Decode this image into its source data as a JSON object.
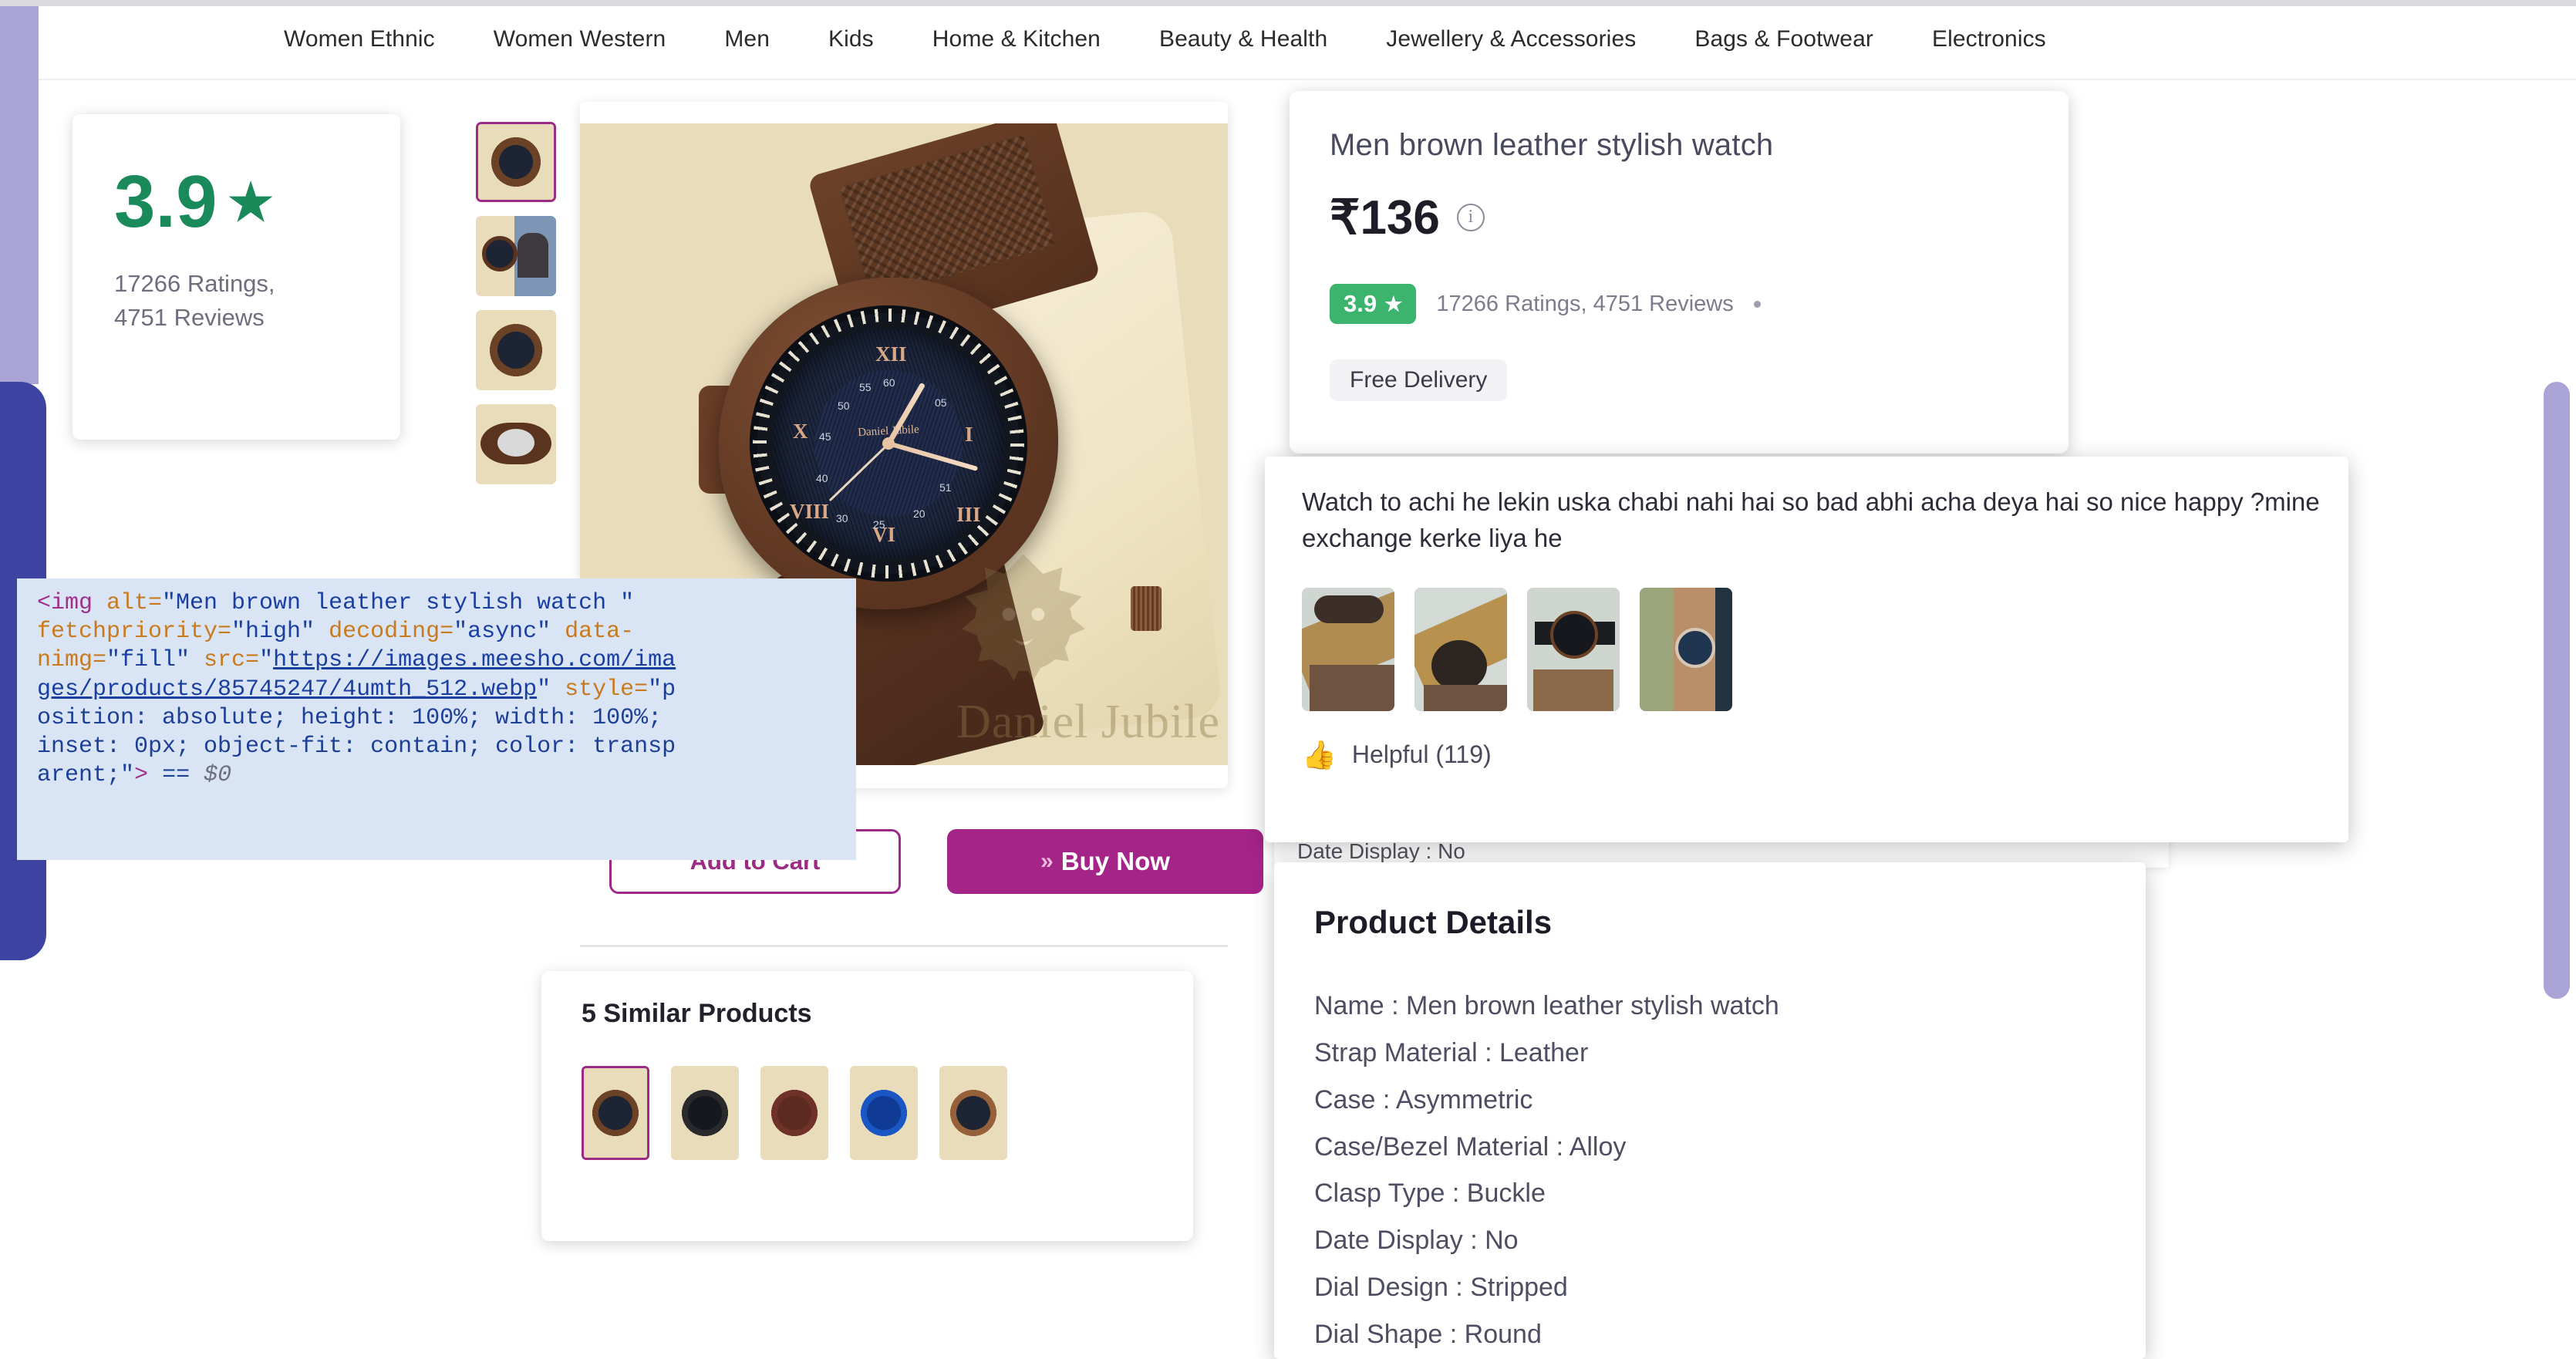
{
  "nav": {
    "items": [
      {
        "label": "Women Ethnic"
      },
      {
        "label": "Women Western"
      },
      {
        "label": "Men"
      },
      {
        "label": "Kids"
      },
      {
        "label": "Home & Kitchen"
      },
      {
        "label": "Beauty & Health"
      },
      {
        "label": "Jewellery & Accessories"
      },
      {
        "label": "Bags & Footwear"
      },
      {
        "label": "Electronics"
      }
    ]
  },
  "rating_card": {
    "score": "3.9",
    "star_glyph": "★",
    "counts_line1": "17266 Ratings,",
    "counts_line2": "4751 Reviews"
  },
  "gallery": {
    "watermark": "Daniel Jubile",
    "brand_on_dial": "Daniel Jubile",
    "thumbnails": [
      {
        "name": "thumb-1-watch-front",
        "selected": true
      },
      {
        "name": "thumb-2-watch-with-model",
        "selected": false
      },
      {
        "name": "thumb-3-watch-angle",
        "selected": false
      },
      {
        "name": "thumb-4-watch-back",
        "selected": false
      }
    ],
    "dial": {
      "romans": [
        "XII",
        "I",
        "III",
        "VI",
        "X",
        "VIII"
      ],
      "minute_numbers": [
        "60",
        "05",
        "51",
        "20",
        "25",
        "30",
        "40",
        "45",
        "50",
        "55"
      ]
    }
  },
  "actions": {
    "add_to_cart_label": "Add to Cart",
    "buy_now_label": "Buy Now",
    "buy_now_chevrons": "»"
  },
  "similar": {
    "title": "5 Similar Products",
    "items": [
      {
        "name": "similar-watch-brown",
        "color1": "#6b4226",
        "color2": "#1d2433",
        "selected": true
      },
      {
        "name": "similar-watch-black",
        "color1": "#2a2a2c",
        "color2": "#15181f",
        "selected": false
      },
      {
        "name": "similar-watch-maroon",
        "color1": "#6e3228",
        "color2": "#5d2a22",
        "selected": false
      },
      {
        "name": "similar-watch-blue",
        "color1": "#1b57c4",
        "color2": "#0f3b95",
        "selected": false
      },
      {
        "name": "similar-watch-tan",
        "color1": "#96603a",
        "color2": "#1d2433",
        "selected": false
      }
    ]
  },
  "price_card": {
    "title": "Men brown leather stylish watch",
    "price": "₹136",
    "info_glyph": "i",
    "rating_badge": "3.9",
    "rating_star": "★",
    "rating_counts": "17266 Ratings, 4751 Reviews",
    "delivery_label": "Free Delivery"
  },
  "review_card": {
    "text": "Watch to achi he lekin uska chabi nahi hai so bad abhi acha deya hai so nice happy ?mine exchange kerke liya he",
    "helpful_label": "Helpful (119)",
    "thumbs_up_glyph": "👍",
    "photos": [
      {
        "name": "review-photo-1",
        "c1": "#cfd6d2",
        "c2": "#b08b52",
        "c3": "#3b2f27"
      },
      {
        "name": "review-photo-2",
        "c1": "#d3dad6",
        "c2": "#b9914f",
        "c3": "#2c2520"
      },
      {
        "name": "review-photo-3",
        "c1": "#cfd5cf",
        "c2": "#8b6a4c",
        "c3": "#1b1d21"
      },
      {
        "name": "review-photo-4",
        "c1": "#9aa57c",
        "c2": "#b98f6a",
        "c3": "#23323f"
      }
    ]
  },
  "details_bg_strip": {
    "text": "Date Display : No"
  },
  "details_card": {
    "title": "Product Details",
    "rows": [
      "Name : Men brown leather stylish watch",
      "Strap Material : Leather",
      "Case : Asymmetric",
      "Case/Bezel Material : Alloy",
      "Clasp Type : Buckle",
      "Date Display : No",
      "Dial Design : Stripped",
      "Dial Shape : Round"
    ]
  },
  "devtools_tooltip": {
    "lines": [
      [
        {
          "t": "tag",
          "v": "<img "
        },
        {
          "t": "attr",
          "v": "alt="
        },
        {
          "t": "val",
          "v": "\"Men brown leather stylish watch \""
        }
      ],
      [
        {
          "t": "attr",
          "v": "fetchpriority="
        },
        {
          "t": "val",
          "v": "\"high\" "
        },
        {
          "t": "attr",
          "v": "decoding="
        },
        {
          "t": "val",
          "v": "\"async\" "
        },
        {
          "t": "attr",
          "v": "data-"
        }
      ],
      [
        {
          "t": "attr",
          "v": "nimg="
        },
        {
          "t": "val",
          "v": "\"fill\" "
        },
        {
          "t": "attr",
          "v": "src="
        },
        {
          "t": "val",
          "v": "\""
        },
        {
          "t": "link",
          "v": "https://images.meesho.com/ima"
        }
      ],
      [
        {
          "t": "link",
          "v": "ges/products/85745247/4umth_512.webp"
        },
        {
          "t": "val",
          "v": "\" "
        },
        {
          "t": "attr",
          "v": "style="
        },
        {
          "t": "val",
          "v": "\"p"
        }
      ],
      [
        {
          "t": "plain",
          "v": "osition: absolute; height: 100%; width: 100%;"
        }
      ],
      [
        {
          "t": "plain",
          "v": "inset: 0px; object-fit: contain; color: transp"
        }
      ],
      [
        {
          "t": "plain",
          "v": "arent;"
        },
        {
          "t": "val",
          "v": "\""
        },
        {
          "t": "tag",
          "v": ">"
        },
        {
          "t": "plain",
          "v": " == "
        },
        {
          "t": "dollar",
          "v": "$0"
        }
      ]
    ]
  },
  "colors": {
    "accent_magenta": "#a52488",
    "green": "#3cb46e",
    "rating_green": "#1a8a5a",
    "purple_bar": "#a9a3d6",
    "blue_panel": "#3c43a0",
    "tooltip_bg": "#d9e5f5"
  }
}
